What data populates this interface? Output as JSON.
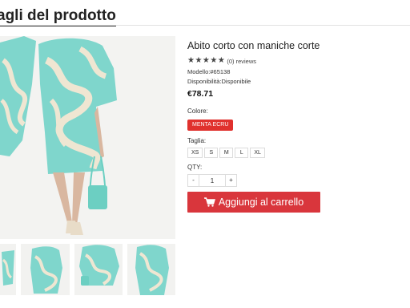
{
  "page": {
    "title": "agli del prodotto"
  },
  "product": {
    "name": "Abito corto con maniche corte",
    "stars": "★★★★★",
    "reviews": "(0) reviews",
    "model": "Modello:#65138",
    "availability": "Disponibilità:Disponibile",
    "price": "€78.71"
  },
  "options": {
    "color_label": "Colore:",
    "color_selected": "MENTA ECRU",
    "size_label": "Taglia:",
    "sizes": [
      "XS",
      "S",
      "M",
      "L",
      "XL"
    ],
    "qty_label": "QTY:",
    "qty_minus": "-",
    "qty_value": "1",
    "qty_plus": "+"
  },
  "cart": {
    "label": "Aggiungi al carrello",
    "icon": "cart-icon"
  },
  "colors": {
    "accent": "#d9363c",
    "mint": "#7fd6cc",
    "ecru": "#efe6d2"
  }
}
